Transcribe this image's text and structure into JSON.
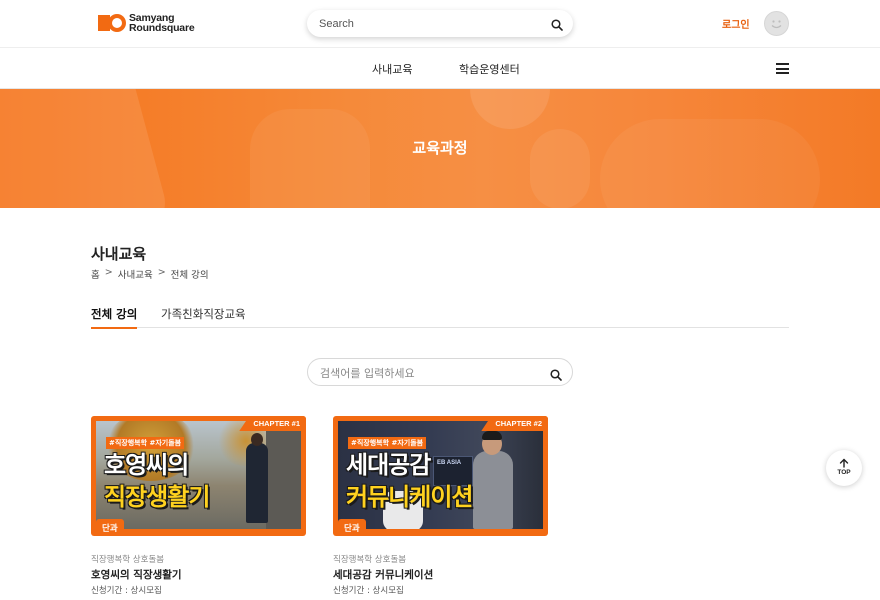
{
  "header": {
    "logo_line1": "Samyang",
    "logo_line2": "Roundsquare",
    "search_placeholder": "Search",
    "login_label": "로그인"
  },
  "nav": {
    "items": [
      {
        "label": "사내교육"
      },
      {
        "label": "학습운영센터"
      }
    ]
  },
  "banner": {
    "title": "교육과정"
  },
  "section": {
    "title": "사내교육",
    "breadcrumb": [
      "홈",
      "사내교육",
      "전체 강의"
    ],
    "breadcrumb_sep": ">"
  },
  "tabs": [
    {
      "label": "전체 강의",
      "active": true
    },
    {
      "label": "가족친화직장교육",
      "active": false
    }
  ],
  "search": {
    "placeholder": "검색어를 입력하세요"
  },
  "courses": [
    {
      "chapter": "CHAPTER #1",
      "hashtags": "#직장행복학 #자기돌봄",
      "thumb_line1": "호영씨의",
      "thumb_line2": "직장생활기",
      "badge": "단과",
      "category": "직장행복학 상호돌봄",
      "title": "호영씨의 직장생활기",
      "period": "신청기간 : 상시모집"
    },
    {
      "chapter": "CHAPTER #2",
      "hashtags": "#직장행복학 #자기돌봄",
      "thumb_line1": "세대공감",
      "thumb_line2": "커뮤니케이션",
      "screen_text": "EB ASIA",
      "badge": "단과",
      "category": "직장행복학 상호돌봄",
      "title": "세대공감 커뮤니케이션",
      "period": "신청기간 : 상시모집"
    }
  ],
  "top_button": {
    "label": "TOP"
  },
  "colors": {
    "accent": "#f26a12",
    "login": "#e8600f"
  }
}
